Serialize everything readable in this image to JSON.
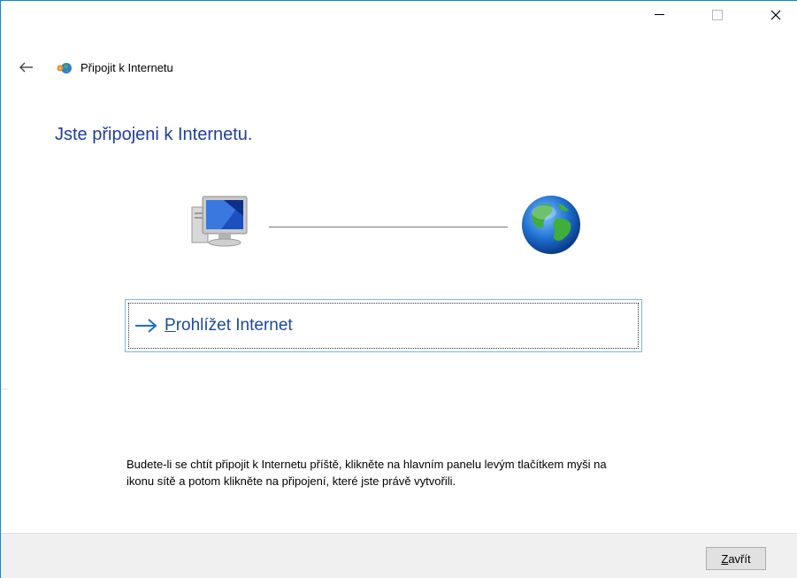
{
  "window": {
    "title": "Připojit k Internetu",
    "caption_buttons": {
      "minimize_icon": "minimize-icon",
      "maximize_icon": "maximize-icon",
      "close_icon": "close-icon"
    }
  },
  "main": {
    "heading": "Jste připojeni k Internetu.",
    "command_link": {
      "label_first": "P",
      "label_rest": "rohlížet Internet"
    },
    "info": "Budete-li se chtít připojit k Internetu příště, klikněte na hlavním panelu levým tlačítkem myši na ikonu sítě a potom klikněte na připojení, které jste právě vytvořili."
  },
  "footer": {
    "close_first": "Z",
    "close_rest": "avřít"
  },
  "colors": {
    "accent": "#1883d7",
    "heading": "#1e3f9b",
    "link": "#1a4a9e"
  },
  "icons": [
    "back-arrow-icon",
    "network-globe-icon",
    "computer-icon",
    "globe-icon",
    "arrow-right-icon"
  ]
}
